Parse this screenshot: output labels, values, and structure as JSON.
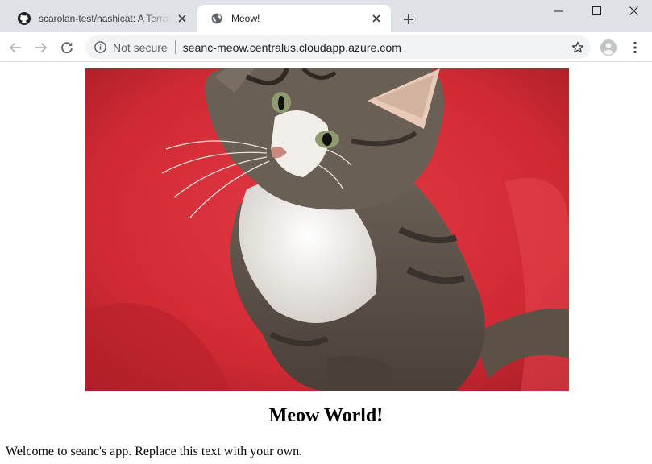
{
  "browser": {
    "tabs": [
      {
        "title": "scarolan-test/hashicat: A Terraform",
        "favicon": "github-icon",
        "active": false
      },
      {
        "title": "Meow!",
        "favicon": "globe-icon",
        "active": true
      }
    ],
    "address_bar": {
      "security_label": "Not secure",
      "url": "seanc-meow.centralus.cloudapp.azure.com"
    }
  },
  "page": {
    "image_subject": "tabby kitten on red background",
    "heading": "Meow World!",
    "paragraph": "Welcome to seanc's app. Replace this text with your own."
  },
  "colors": {
    "tabstrip": "#dee1e6",
    "omnibox": "#f1f3f4",
    "photo_background": "#d8303a"
  }
}
